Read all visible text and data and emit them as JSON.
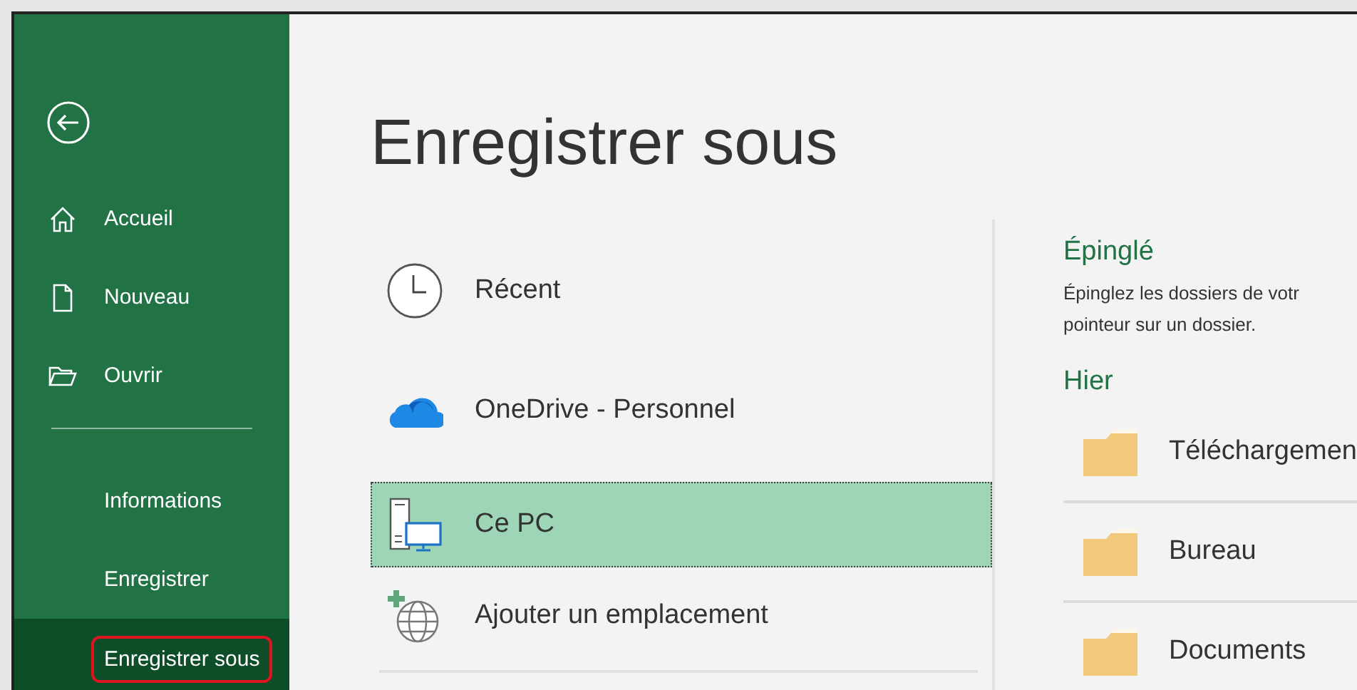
{
  "sidebar": {
    "items": [
      {
        "kind": "back"
      },
      {
        "kind": "icon",
        "label": "Accueil",
        "selected": false
      },
      {
        "kind": "icon",
        "label": "Nouveau",
        "selected": false
      },
      {
        "kind": "icon",
        "label": "Ouvrir",
        "selected": false
      },
      {
        "kind": "divider"
      },
      {
        "kind": "text",
        "label": "Informations",
        "selected": false
      },
      {
        "kind": "text",
        "label": "Enregistrer",
        "selected": false
      },
      {
        "kind": "text",
        "label": "Enregistrer sous",
        "selected": true,
        "outlined": true
      }
    ]
  },
  "title": "Enregistrer sous",
  "locations": [
    {
      "label": "Récent",
      "selected": false
    },
    {
      "label": "OneDrive - Personnel",
      "selected": false
    },
    {
      "label": "Ce PC",
      "selected": true
    },
    {
      "label": "Ajouter un emplacement",
      "selected": false
    }
  ],
  "pinned": {
    "heading": "Épinglé",
    "lines": [
      "Épinglez les dossiers de votr",
      "pointeur sur un dossier."
    ]
  },
  "recent": {
    "heading": "Hier",
    "folders": [
      "Téléchargemen",
      "Bureau",
      "Documents"
    ]
  }
}
